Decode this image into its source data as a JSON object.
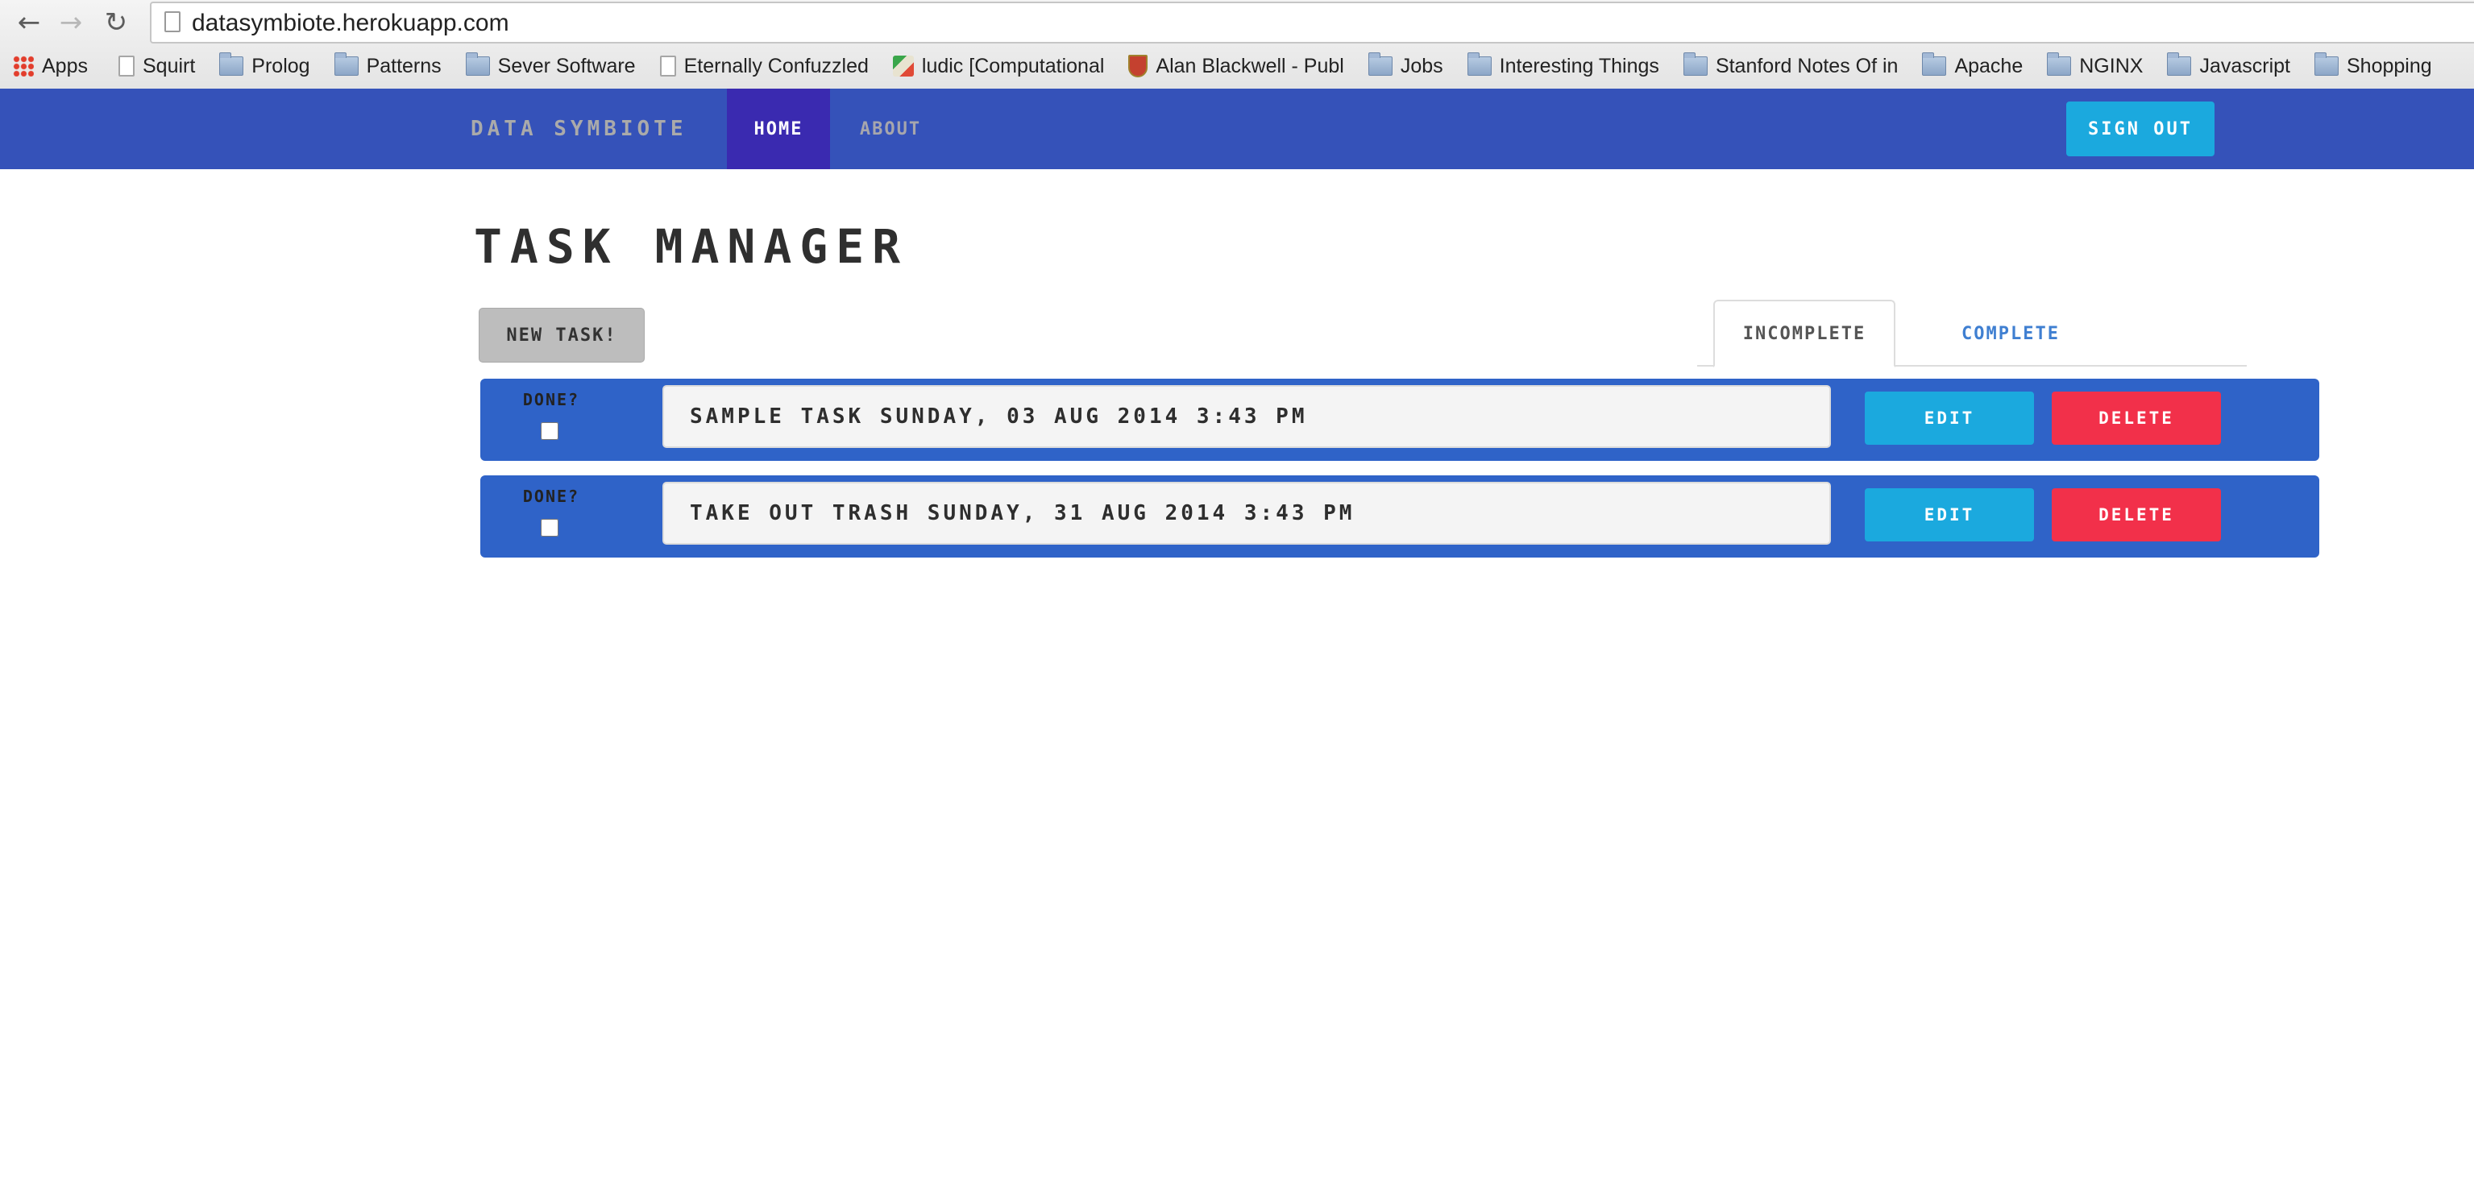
{
  "browser": {
    "url": "datasymbiote.herokuapp.com",
    "bookmarks": [
      {
        "label": "Apps",
        "icon": "apps-icon"
      },
      {
        "label": "Squirt",
        "icon": "page-icon"
      },
      {
        "label": "Prolog",
        "icon": "folder-icon"
      },
      {
        "label": "Patterns",
        "icon": "folder-icon"
      },
      {
        "label": "Sever Software",
        "icon": "folder-icon"
      },
      {
        "label": "Eternally Confuzzled",
        "icon": "page-icon"
      },
      {
        "label": "ludic [Computational",
        "icon": "ludic-icon"
      },
      {
        "label": "Alan Blackwell - Publ",
        "icon": "crest-icon"
      },
      {
        "label": "Jobs",
        "icon": "folder-icon"
      },
      {
        "label": "Interesting Things",
        "icon": "folder-icon"
      },
      {
        "label": "Stanford Notes Of in",
        "icon": "folder-icon"
      },
      {
        "label": "Apache",
        "icon": "folder-icon"
      },
      {
        "label": "NGINX",
        "icon": "folder-icon"
      },
      {
        "label": "Javascript",
        "icon": "folder-icon"
      },
      {
        "label": "Shopping",
        "icon": "folder-icon"
      }
    ]
  },
  "navbar": {
    "brand": "Data Symbiote",
    "home": "Home",
    "about": "About",
    "sign_out": "Sign Out"
  },
  "page": {
    "title": "Task Manager",
    "new_task": "New Task!",
    "tabs": {
      "incomplete": "Incomplete",
      "complete": "Complete"
    }
  },
  "tasks": [
    {
      "done_label": "Done?",
      "text": "Sample Task Sunday, 03 Aug 2014 3:43 PM",
      "edit": "Edit",
      "delete": "Delete"
    },
    {
      "done_label": "Done?",
      "text": "Take out Trash Sunday, 31 Aug 2014 3:43 PM",
      "edit": "Edit",
      "delete": "Delete"
    }
  ],
  "colors": {
    "navbar": "#3552b9",
    "nav_active": "#3a2ab0",
    "task_row": "#2f63c8",
    "edit": "#1ba9de",
    "delete": "#f2304a"
  }
}
